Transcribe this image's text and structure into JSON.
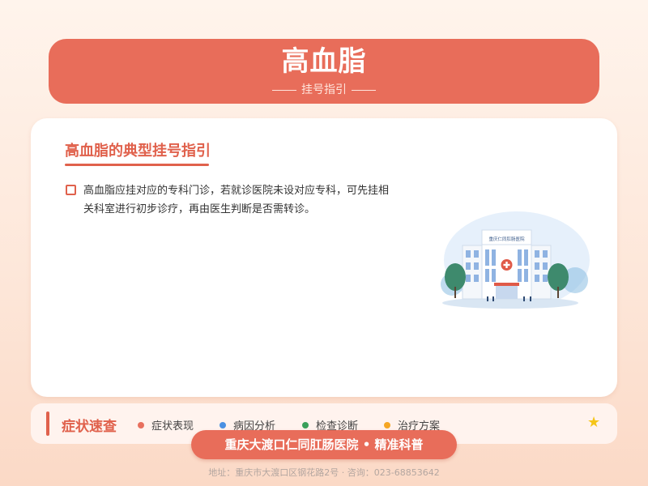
{
  "header": {
    "title": "高血脂",
    "subtitle": "挂号指引"
  },
  "content": {
    "section_title": "高血脂的典型挂号指引",
    "paragraph": "高血脂应挂对应的专科门诊，若就诊医院未设对应专科，可先挂相关科室进行初步诊疗，再由医生判断是否需转诊。",
    "illustration": {
      "icon": "hospital-building-icon",
      "sign_text": "重庆仁同肛肠医院"
    }
  },
  "symptom_bar": {
    "title": "症状速查",
    "tags": [
      {
        "label": "症状表现",
        "color": "#e8705e"
      },
      {
        "label": "病因分析",
        "color": "#4a90e2"
      },
      {
        "label": "检查诊断",
        "color": "#3aa05a"
      },
      {
        "label": "治疗方案",
        "color": "#f5a623"
      }
    ],
    "star_icon": "star-icon"
  },
  "badge": {
    "text": "重庆大渡口仁同肛肠医院 • 精准科普"
  },
  "footer": {
    "text": "地址：重庆市大渡口区钢花路2号 · 咨询：023-68853642"
  },
  "colors": {
    "accent": "#e86d5a",
    "title_red": "#e0614c"
  }
}
